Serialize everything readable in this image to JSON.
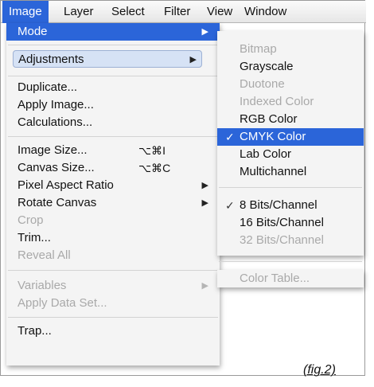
{
  "menubar": {
    "items": [
      "Image",
      "Layer",
      "Select",
      "Filter",
      "View",
      "Window"
    ]
  },
  "image_menu": {
    "mode": "Mode",
    "adjustments": "Adjustments",
    "duplicate": "Duplicate...",
    "apply_image": "Apply Image...",
    "calculations": "Calculations...",
    "image_size": "Image Size...",
    "image_size_shortcut": "⌥⌘I",
    "canvas_size": "Canvas Size...",
    "canvas_size_shortcut": "⌥⌘C",
    "pixel_aspect_ratio": "Pixel Aspect Ratio",
    "rotate_canvas": "Rotate Canvas",
    "crop": "Crop",
    "trim": "Trim...",
    "reveal_all": "Reveal All",
    "variables": "Variables",
    "apply_data_set": "Apply Data Set...",
    "trap": "Trap...",
    "arrow": "▶"
  },
  "mode_submenu": {
    "bitmap": "Bitmap",
    "grayscale": "Grayscale",
    "duotone": "Duotone",
    "indexed_color": "Indexed Color",
    "rgb_color": "RGB Color",
    "cmyk_color": "CMYK Color",
    "lab_color": "Lab Color",
    "multichannel": "Multichannel",
    "bits8": "8 Bits/Channel",
    "bits16": "16 Bits/Channel",
    "bits32": "32 Bits/Channel",
    "color_table": "Color Table...",
    "check": "✓"
  },
  "caption": "(fig.2)",
  "colors": {
    "highlight": "#2b65d9",
    "disabled": "#a9a9a9"
  }
}
